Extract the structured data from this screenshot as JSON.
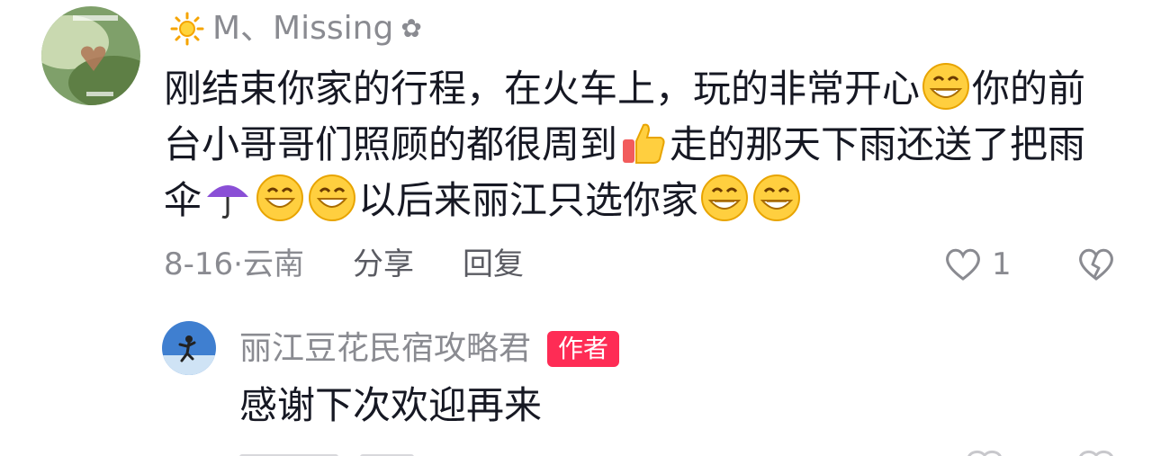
{
  "comments": [
    {
      "username": "M、Missing",
      "text_part1": "刚结束你家的行程，在火车上，玩的非常开心",
      "text_part2": "你的前台小哥哥们照顾的都很周到",
      "text_part3": "走的那天下雨还送了把雨伞",
      "text_part4": "以后来丽江只选你家",
      "date": "8-16·云南",
      "share_label": "分享",
      "reply_label": "回复",
      "like_count": "1"
    },
    {
      "username": "丽江豆花民宿攻略君",
      "badge": "作者",
      "text": "感谢下次欢迎再来"
    }
  ],
  "icons": {
    "username_prefix": "sun-icon",
    "username_suffix": "flower-icon",
    "emojis": [
      "grin-emoji",
      "thumbs-up-emoji",
      "umbrella-emoji",
      "smile-emoji",
      "smile-emoji",
      "grin-emoji",
      "grin-emoji"
    ],
    "like": "heart-outline-icon",
    "dislike": "broken-heart-icon"
  },
  "colors": {
    "badge_bg": "#fe2c55",
    "secondary_text": "#8a8b91",
    "primary_text": "#161823"
  }
}
